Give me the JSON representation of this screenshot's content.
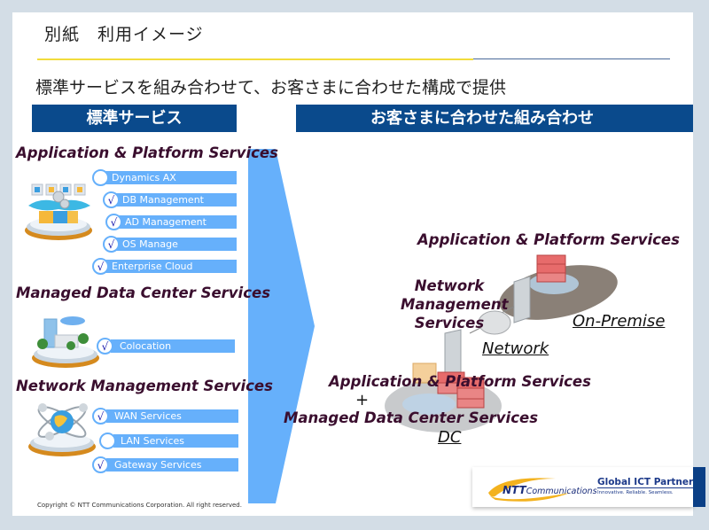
{
  "header": {
    "title": "別紙　利用イメージ",
    "subtitle": "標準サービスを組み合わせて、お客さまに合わせた構成で提供"
  },
  "columns": {
    "left_header": "標準サービス",
    "right_header": "お客さまに合わせた組み合わせ"
  },
  "left": {
    "sections": [
      {
        "title": "Application & Platform Services",
        "icon": "application-platform-icon",
        "items": [
          {
            "label": "Dynamics AX",
            "checked": false
          },
          {
            "label": "DB Management",
            "checked": true
          },
          {
            "label": "AD Management",
            "checked": true
          },
          {
            "label": "OS Manage",
            "checked": true
          },
          {
            "label": "Enterprise Cloud",
            "checked": true
          }
        ]
      },
      {
        "title": "Managed Data Center Services",
        "icon": "data-center-icon",
        "items": [
          {
            "label": "Colocation",
            "checked": true
          }
        ]
      },
      {
        "title": "Network Management Services",
        "icon": "network-globe-icon",
        "items": [
          {
            "label": "WAN Services",
            "checked": true
          },
          {
            "label": "LAN Services",
            "checked": false
          },
          {
            "label": "Gateway Services",
            "checked": true
          }
        ]
      }
    ],
    "check_glyph": "√"
  },
  "right": {
    "onprem_services": "Application & Platform Services",
    "network_services_lines": [
      "Network",
      "Management",
      "Services"
    ],
    "onprem_label": "On-Premise",
    "network_label": "Network",
    "dc_services_line1": "Application & Platform Services",
    "plus": "+",
    "dc_services_line2": "Managed Data Center Services",
    "dc_label": "DC"
  },
  "footer": {
    "copyright": "Copyright © NTT Communications Corporation. All right reserved.",
    "logo_name": "NTT Communications",
    "logo_ntt": "NTT",
    "logo_comm": "Communications",
    "tagline_title": "Global ICT Partner",
    "tagline_sub": "Innovative. Reliable. Seamless."
  },
  "colors": {
    "header_bar": "#0a4a8c",
    "pill": "#66b0fb",
    "section_title": "#3a0e2e",
    "accent_yellow": "#f2dc3c"
  }
}
